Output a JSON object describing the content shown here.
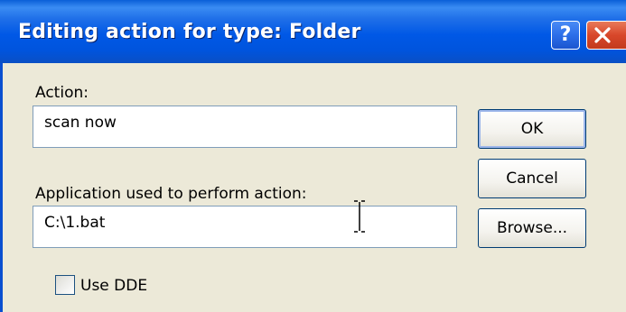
{
  "dialog": {
    "title": "Editing action for type: Folder",
    "help_button": "?",
    "close_icon": "close-icon"
  },
  "action": {
    "label": "Action:",
    "value": "scan now"
  },
  "application": {
    "label": "Application used to perform action:",
    "value": "C:\\1.bat"
  },
  "buttons": {
    "ok": "OK",
    "cancel": "Cancel",
    "browse": "Browse..."
  },
  "dde": {
    "label": "Use DDE",
    "checked": false
  },
  "colors": {
    "titlebar": "#0054e3",
    "dialog_bg": "#ece9d8",
    "close_red": "#d8472a"
  }
}
